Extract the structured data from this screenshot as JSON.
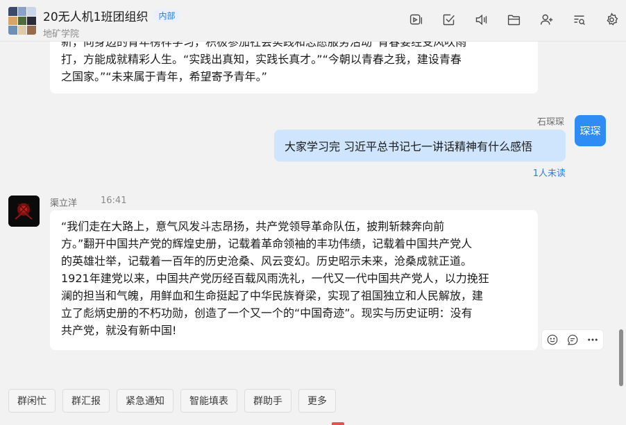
{
  "header": {
    "title": "20无人机1班团组织",
    "tag": "内部",
    "subtitle": "地矿学院",
    "toolbar": [
      {
        "icon": "video-icon"
      },
      {
        "icon": "checkbox-icon"
      },
      {
        "icon": "speaker-icon"
      },
      {
        "icon": "folder-icon"
      },
      {
        "icon": "add-member-icon"
      },
      {
        "icon": "search-history-icon"
      },
      {
        "icon": "settings-icon"
      }
    ]
  },
  "messages": {
    "first": {
      "text": "新，向身边的青年榜样学习，积极参加社会实践和志愿服务活动“青春要经受风吹雨\n打，方能成就精彩人生。“实践出真知，实践长真才。”“今朝以青春之我，建设青春\n之国家。”“未来属于青年，希望寄予青年。”"
    },
    "self": {
      "name": "石琛琛",
      "avatar_text": "琛琛",
      "text": "大家学习完 习近平总书记七一讲话精神有什么感悟",
      "read_status": "1人未读"
    },
    "other": {
      "name": "渠立洋",
      "time": "16:41",
      "text": "“我们走在大路上，意气风发斗志昂扬，共产党领导革命队伍，披荆斩棘奔向前\n方。”翻开中国共产党的辉煌史册，记载着革命领袖的丰功伟绩，记载着中国共产党人\n的英雄壮举，记载着一百年的历史沧桑、风云变幻。历史昭示未来，沧桑成就正道。\n1921年建党以来，中国共产党历经百载风雨洗礼，一代又一代中国共产党人，以力挽狂\n澜的担当和气魄，用鲜血和生命挺起了中华民族脊梁，实现了祖国独立和人民解放，建\n立了彪炳史册的不朽功勋，创造了一个又一个的“中国奇迹”。现实与历史证明：没有\n共产党，就没有新中国!"
    }
  },
  "message_actions": [
    {
      "icon": "emoji-icon"
    },
    {
      "icon": "reply-icon"
    },
    {
      "icon": "more-icon"
    }
  ],
  "quick_buttons": [
    "群闲忙",
    "群汇报",
    "紧急通知",
    "智能填表",
    "群助手",
    "更多"
  ],
  "colors": {
    "accent": "#2c7be5",
    "self_bubble": "#cfe4fd",
    "self_avatar": "#2f8cf5"
  }
}
